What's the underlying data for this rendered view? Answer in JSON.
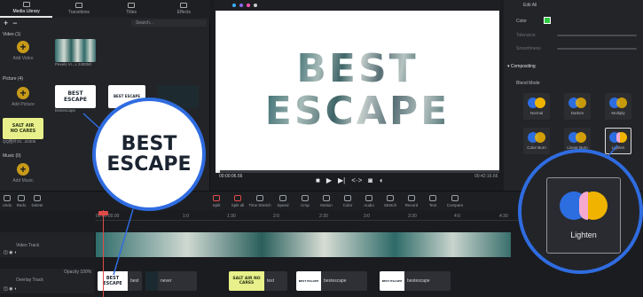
{
  "tabs": [
    {
      "label": "Media Library",
      "active": true
    },
    {
      "label": "Transitions"
    },
    {
      "label": "Titles"
    },
    {
      "label": "Effects"
    }
  ],
  "search": {
    "placeholder": "Search..."
  },
  "media": {
    "video_header": "Video (1)",
    "picture_header": "Picture (4)",
    "music_header": "Music (0)",
    "add_video": "Add Video",
    "add_picture": "Add Picture",
    "add_music": "Add Music",
    "video_caption": "Pexels Vi...x 240050",
    "picture_caption": "bestescape",
    "salt_caption": "QQ图片20...20305",
    "best_text": [
      "BEST",
      "ESCAPE"
    ],
    "salt_text": [
      "SALT AIR",
      "NO CARES"
    ]
  },
  "preview": {
    "text_line1": "BEST",
    "text_line2": "ESCAPE",
    "time_current": "00:00:06.56",
    "time_total": "00:42:16.66"
  },
  "right_panel": {
    "edit_all": "Edit All",
    "color_label": "Color",
    "tolerance_label": "Tolerance",
    "smoothness_label": "Smoothness",
    "compositing_label": "Compositing",
    "blend_mode_label": "Blend Mode",
    "blend_modes": [
      "Normal",
      "Darken",
      "Multiply",
      "Color Burn",
      "Linear Burn",
      "Lighten"
    ],
    "accent_color": "#2f6ce0",
    "key_color": "#2ecc40"
  },
  "toolbar": {
    "left_tools": [
      "Undo",
      "Redo",
      "Delete"
    ],
    "tools": [
      "Split",
      "Split all",
      "Time Stretch",
      "Speed",
      "Crop",
      "Motion",
      "Color",
      "Audio",
      "Stretch",
      "Record",
      "Text",
      "Compare"
    ],
    "right_tool": "Color"
  },
  "timeline": {
    "ruler_ticks": [
      "00:00:00.00",
      "1:0",
      "1:30",
      "2:0",
      "2:30",
      "3:0",
      "3:30",
      "4:0",
      "4:30"
    ],
    "playhead_time": "00:00:06.56",
    "video_track_label": "Video Track",
    "overlay_track_label": "Overlay Track",
    "opacity_label": "Opacity 100%",
    "clips": [
      {
        "thumb": "BEST ESCAPE",
        "label": "best"
      },
      {
        "thumb": "",
        "label": "never"
      },
      {
        "thumb": "SALT AIR NO CARES",
        "label": "text"
      },
      {
        "thumb": "BEST ESCAPE",
        "label": "bestescape"
      },
      {
        "thumb": "BEST ESCAPE",
        "label": "bestescape"
      }
    ]
  },
  "callouts": {
    "left_text": [
      "BEST",
      "ESCAPE"
    ],
    "lighten_label": "Lighten"
  }
}
